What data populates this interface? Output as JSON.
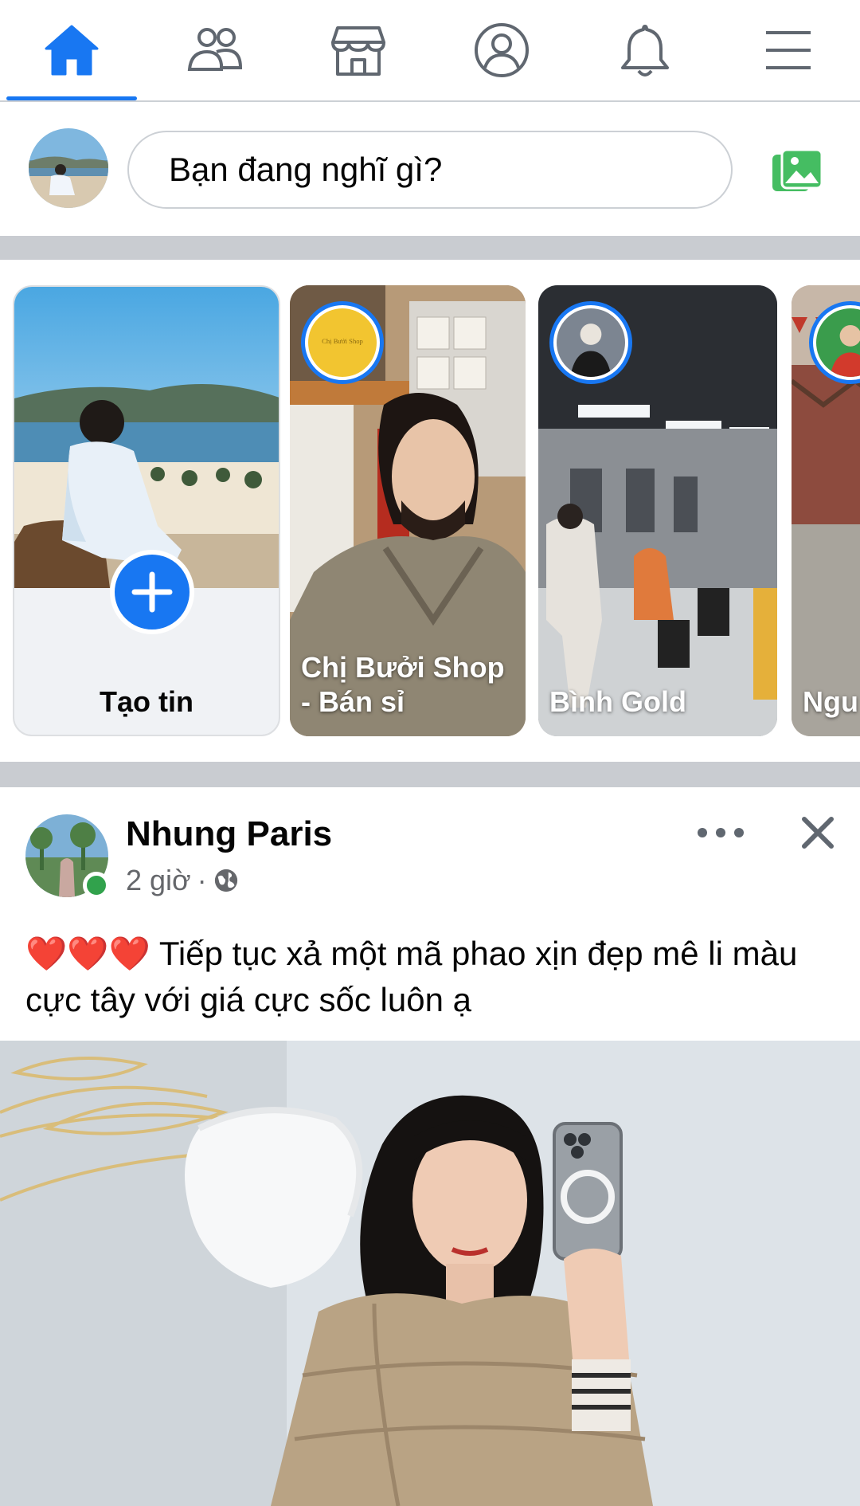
{
  "nav": {
    "tabs": [
      {
        "icon": "home-icon",
        "active": true
      },
      {
        "icon": "friends-icon",
        "active": false
      },
      {
        "icon": "marketplace-icon",
        "active": false
      },
      {
        "icon": "profile-icon",
        "active": false
      },
      {
        "icon": "notifications-icon",
        "active": false
      },
      {
        "icon": "menu-icon",
        "active": false
      }
    ],
    "accent_color": "#1877f2",
    "icon_color": "#606770"
  },
  "composer": {
    "placeholder": "Bạn đang nghĩ gì?",
    "photo_icon": "photo-icon",
    "photo_icon_color": "#45bd62"
  },
  "stories": {
    "create_label": "Tạo tin",
    "items": [
      {
        "name": "Chị Bưởi Shop\n- Bán sỉ"
      },
      {
        "name": "Bình Gold"
      },
      {
        "name": "Ngu"
      }
    ]
  },
  "post": {
    "author": "Nhung Paris",
    "time": "2 giờ",
    "separator": "·",
    "privacy_icon": "globe-icon",
    "hearts": "❤️❤️❤️",
    "text": "Tiếp tục xả một mã phao xịn đẹp mê li màu cực tây với giá cực sốc luôn ạ",
    "more_icon": "more-icon",
    "close_icon": "close-icon"
  }
}
